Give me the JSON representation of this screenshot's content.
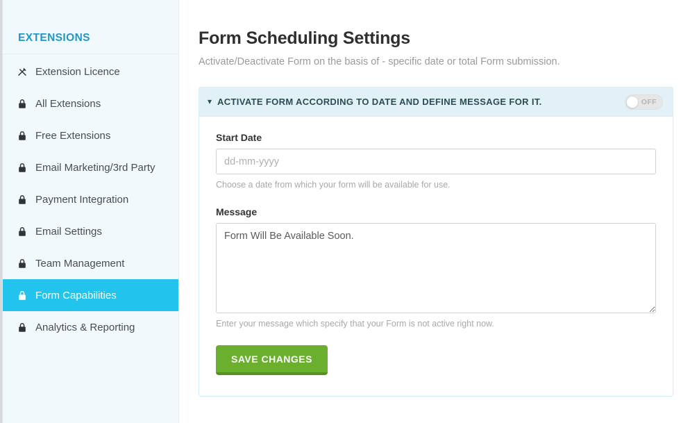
{
  "sidebar": {
    "heading": "EXTENSIONS",
    "items": [
      {
        "label": "Extension Licence",
        "icon": "tools-icon",
        "active": false
      },
      {
        "label": "All Extensions",
        "icon": "lock-icon",
        "active": false
      },
      {
        "label": "Free Extensions",
        "icon": "lock-icon",
        "active": false
      },
      {
        "label": "Email Marketing/3rd Party",
        "icon": "lock-icon",
        "active": false
      },
      {
        "label": "Payment Integration",
        "icon": "lock-icon",
        "active": false
      },
      {
        "label": "Email Settings",
        "icon": "lock-icon",
        "active": false
      },
      {
        "label": "Team Management",
        "icon": "lock-icon",
        "active": false
      },
      {
        "label": "Form Capabilities",
        "icon": "lock-icon",
        "active": true
      },
      {
        "label": "Analytics & Reporting",
        "icon": "lock-icon",
        "active": false
      }
    ]
  },
  "page": {
    "title": "Form Scheduling Settings",
    "subtitle": "Activate/Deactivate Form on the basis of - specific date or total Form submission."
  },
  "panel": {
    "title": "ACTIVATE FORM ACCORDING TO DATE AND DEFINE MESSAGE FOR IT.",
    "collapse_icon": "chevron-down-icon",
    "toggle": {
      "state_label": "OFF",
      "on": false
    },
    "start_date": {
      "label": "Start Date",
      "value": "",
      "placeholder": "dd-mm-yyyy",
      "hint": "Choose a date from which your form will be available for use."
    },
    "message": {
      "label": "Message",
      "value": "Form Will Be Available Soon.",
      "placeholder": "",
      "hint": "Enter your message which specify that your Form is not active right now."
    },
    "save_label": "SAVE CHANGES"
  },
  "colors": {
    "accent_cyan": "#22c3ec",
    "heading_blue": "#2296c6",
    "panel_header_bg": "#e2f1f7",
    "panel_border": "#d6eef8",
    "save_green": "#6ab02e",
    "save_green_dark": "#57921f",
    "sidebar_bg": "#f1f9fc"
  }
}
